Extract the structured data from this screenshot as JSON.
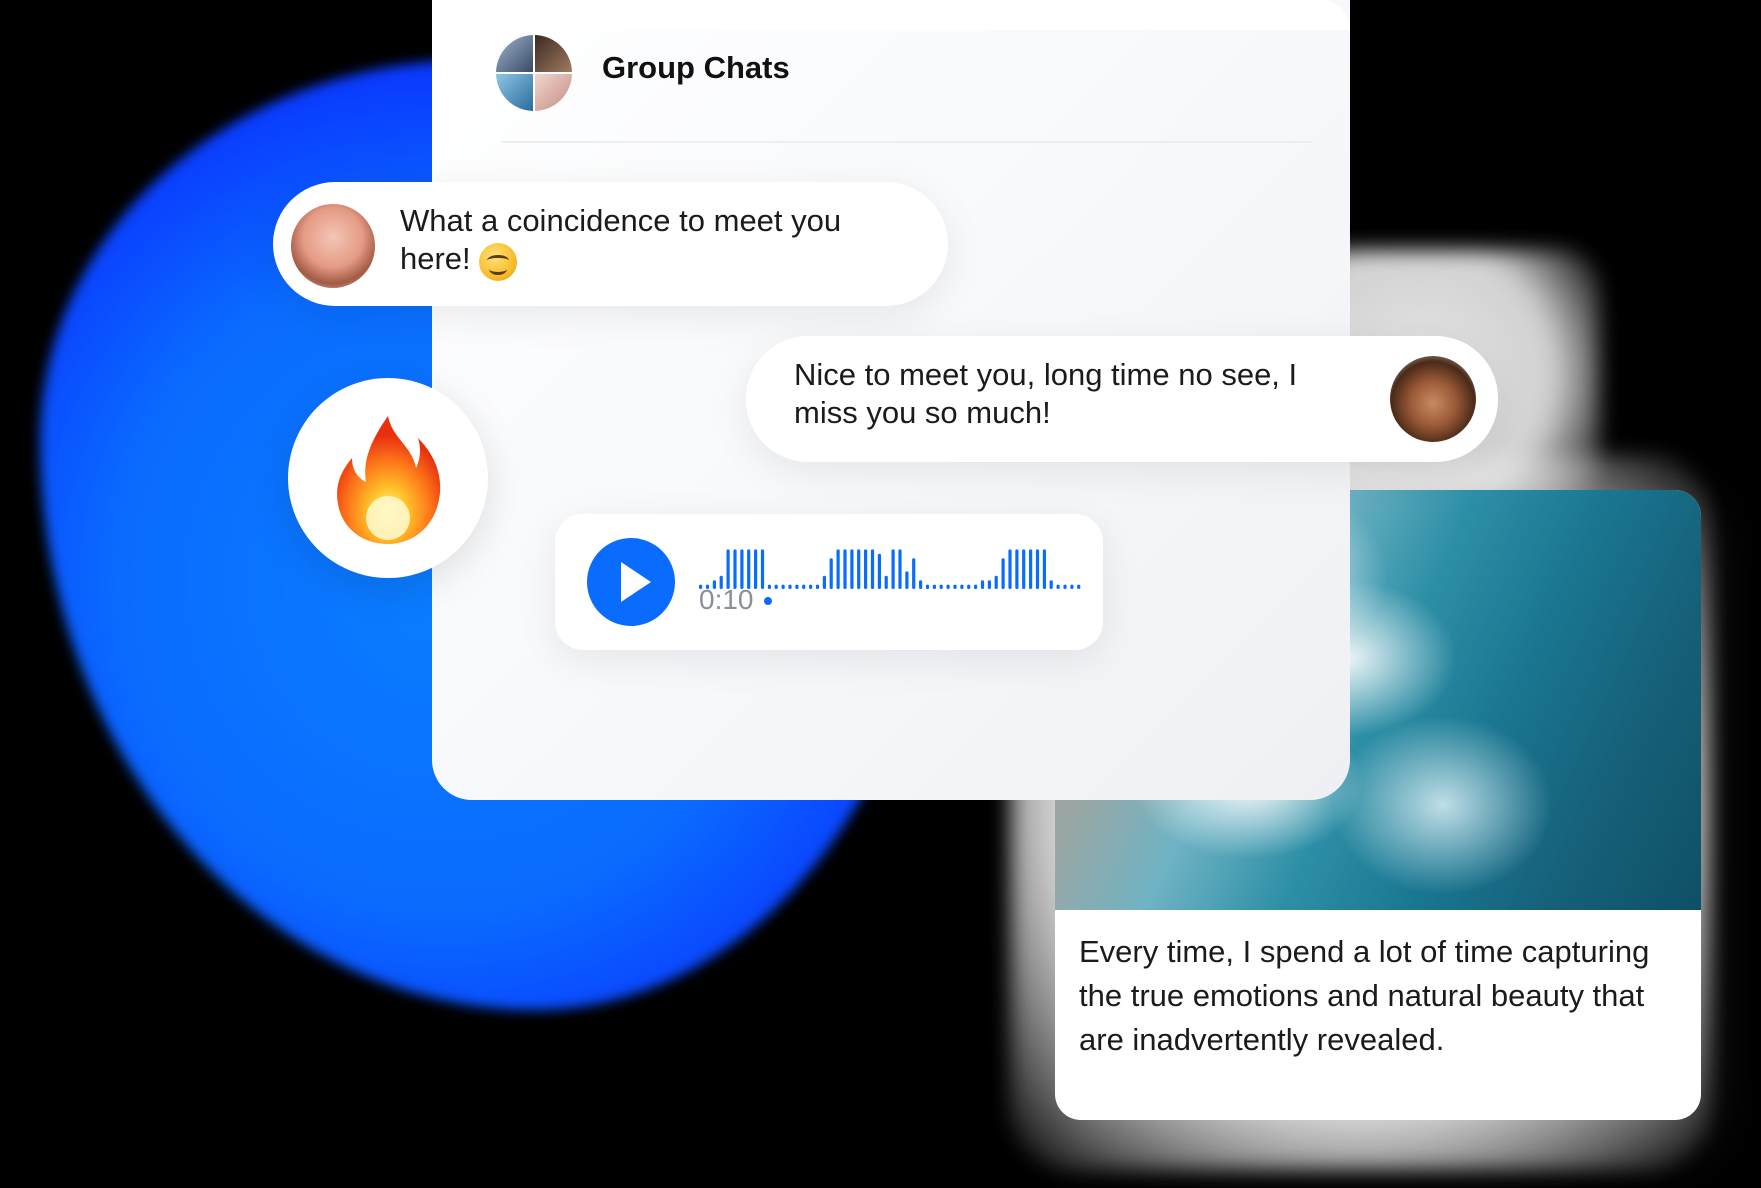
{
  "header": {
    "title": "Group Chats"
  },
  "messages": [
    {
      "text": "What a coincidence to meet you here!",
      "emoji": "smiling-face"
    },
    {
      "text": "Nice to meet you, long time no see, I miss you so much!"
    }
  ],
  "reaction": {
    "emoji": "🔥"
  },
  "audio": {
    "duration": "0:10"
  },
  "photo_post": {
    "caption": "Every time, I spend a lot of time capturing the true emotions and natural beauty that are inadvertently revealed."
  },
  "colors": {
    "accent": "#0a6cff",
    "blob": "#0a6cff",
    "background": "#000000"
  }
}
